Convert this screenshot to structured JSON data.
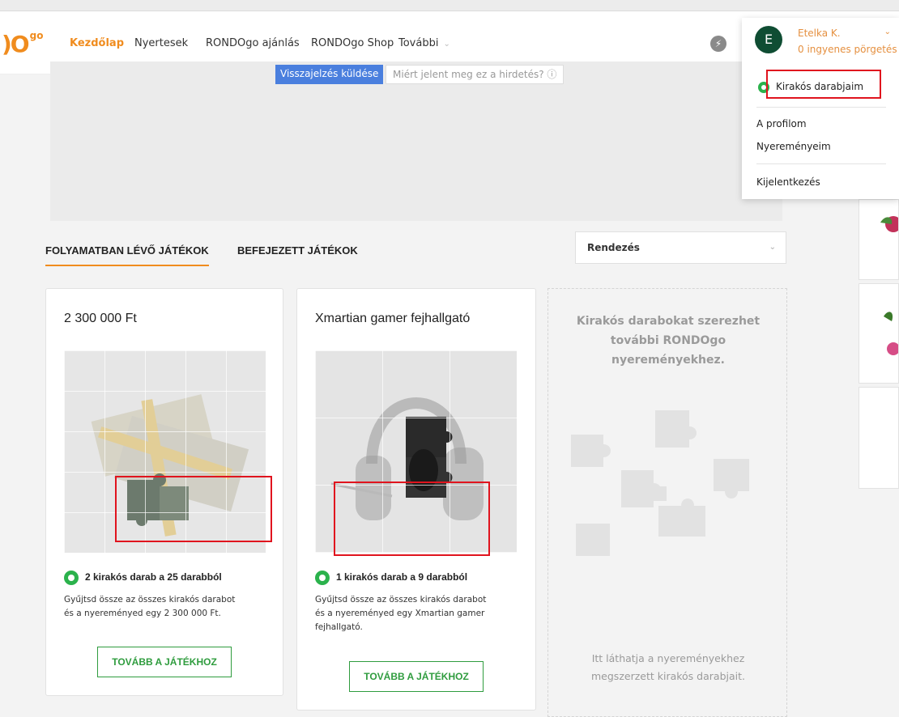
{
  "nav": {
    "logo_text": ")O",
    "logo_sup": "go",
    "links": [
      "Kezdőlap",
      "Nyertesek",
      "RONDOgo ajánlás",
      "RONDOgo Shop",
      "További"
    ]
  },
  "ad": {
    "feedback_button": "Visszajelzés küldése",
    "why_text": "Miért jelent meg ez a hirdetés? ⓘ"
  },
  "tabs": {
    "in_progress": "FOLYAMATBAN LÉVŐ JÁTÉKOK",
    "finished": "BEFEJEZETT JÁTÉKOK"
  },
  "sort": {
    "label": "Rendezés"
  },
  "cards": [
    {
      "title": "2 300 000 Ft",
      "progress": "2 kirakós darab a 25 darabból",
      "desc": "Gyűjtsd össze az összes kirakós darabot és a nyereményed egy 2 300 000 Ft.",
      "cta": "TOVÁBB A JÁTÉKHOZ",
      "pieces_collected": 2,
      "pieces_total": 25
    },
    {
      "title": "Xmartian gamer fejhallgató",
      "progress": "1 kirakós darab a 9 darabból",
      "desc": "Gyűjtsd össze az összes kirakós darabot és a nyereményed egy Xmartian gamer fejhallgató.",
      "cta": "TOVÁBB A JÁTÉKHOZ",
      "pieces_collected": 1,
      "pieces_total": 9
    }
  ],
  "placeholder_card": {
    "info": "Kirakós darabokat szerezhet további RONDOgo nyereményekhez.",
    "footer": "Itt láthatja a nyereményekhez megszerzett kirakós darabjait."
  },
  "user_menu": {
    "avatar_letter": "E",
    "name": "Etelka K.",
    "spins": "0 ingyenes pörgetés",
    "puzzle_pieces": "Kirakós darabjaim",
    "profile": "A profilom",
    "winnings": "Nyereményeim",
    "logout": "Kijelentkezés"
  },
  "colors": {
    "brand_orange": "#f08c1e",
    "green": "#2bb24c",
    "highlight_red": "#e0141e",
    "avatar_green": "#0f4d33"
  }
}
